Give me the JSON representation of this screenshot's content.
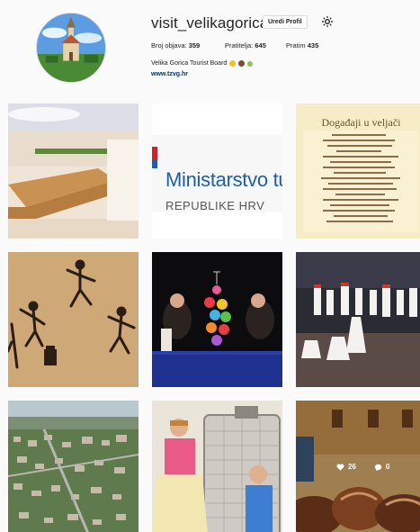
{
  "profile": {
    "username": "visit_velikagorica",
    "edit_label": "Uredi Profil",
    "stats": {
      "posts_label": "Broj objava:",
      "posts_value": "359",
      "followers_label": "Pratitelja:",
      "followers_value": "645",
      "following_label": "Pratim",
      "following_value": "435"
    },
    "full_name": "Velika Gorica Tourist Board",
    "website": "www.tzvg.hr"
  },
  "grid": {
    "poster_title": "Događaji u veljači",
    "ministry_line1": "Ministarstvo tu",
    "ministry_line2": "REPUBLIKE HRV",
    "last_post_likes": "26",
    "last_post_comments": "0"
  },
  "colors": {
    "link": "#003569",
    "background": "#fafafa",
    "border": "#dbdbdb",
    "ministry_blue": "#1d5fa8"
  },
  "icons": {
    "gear": "gear-icon",
    "heart": "heart-icon",
    "comment": "comment-icon"
  }
}
